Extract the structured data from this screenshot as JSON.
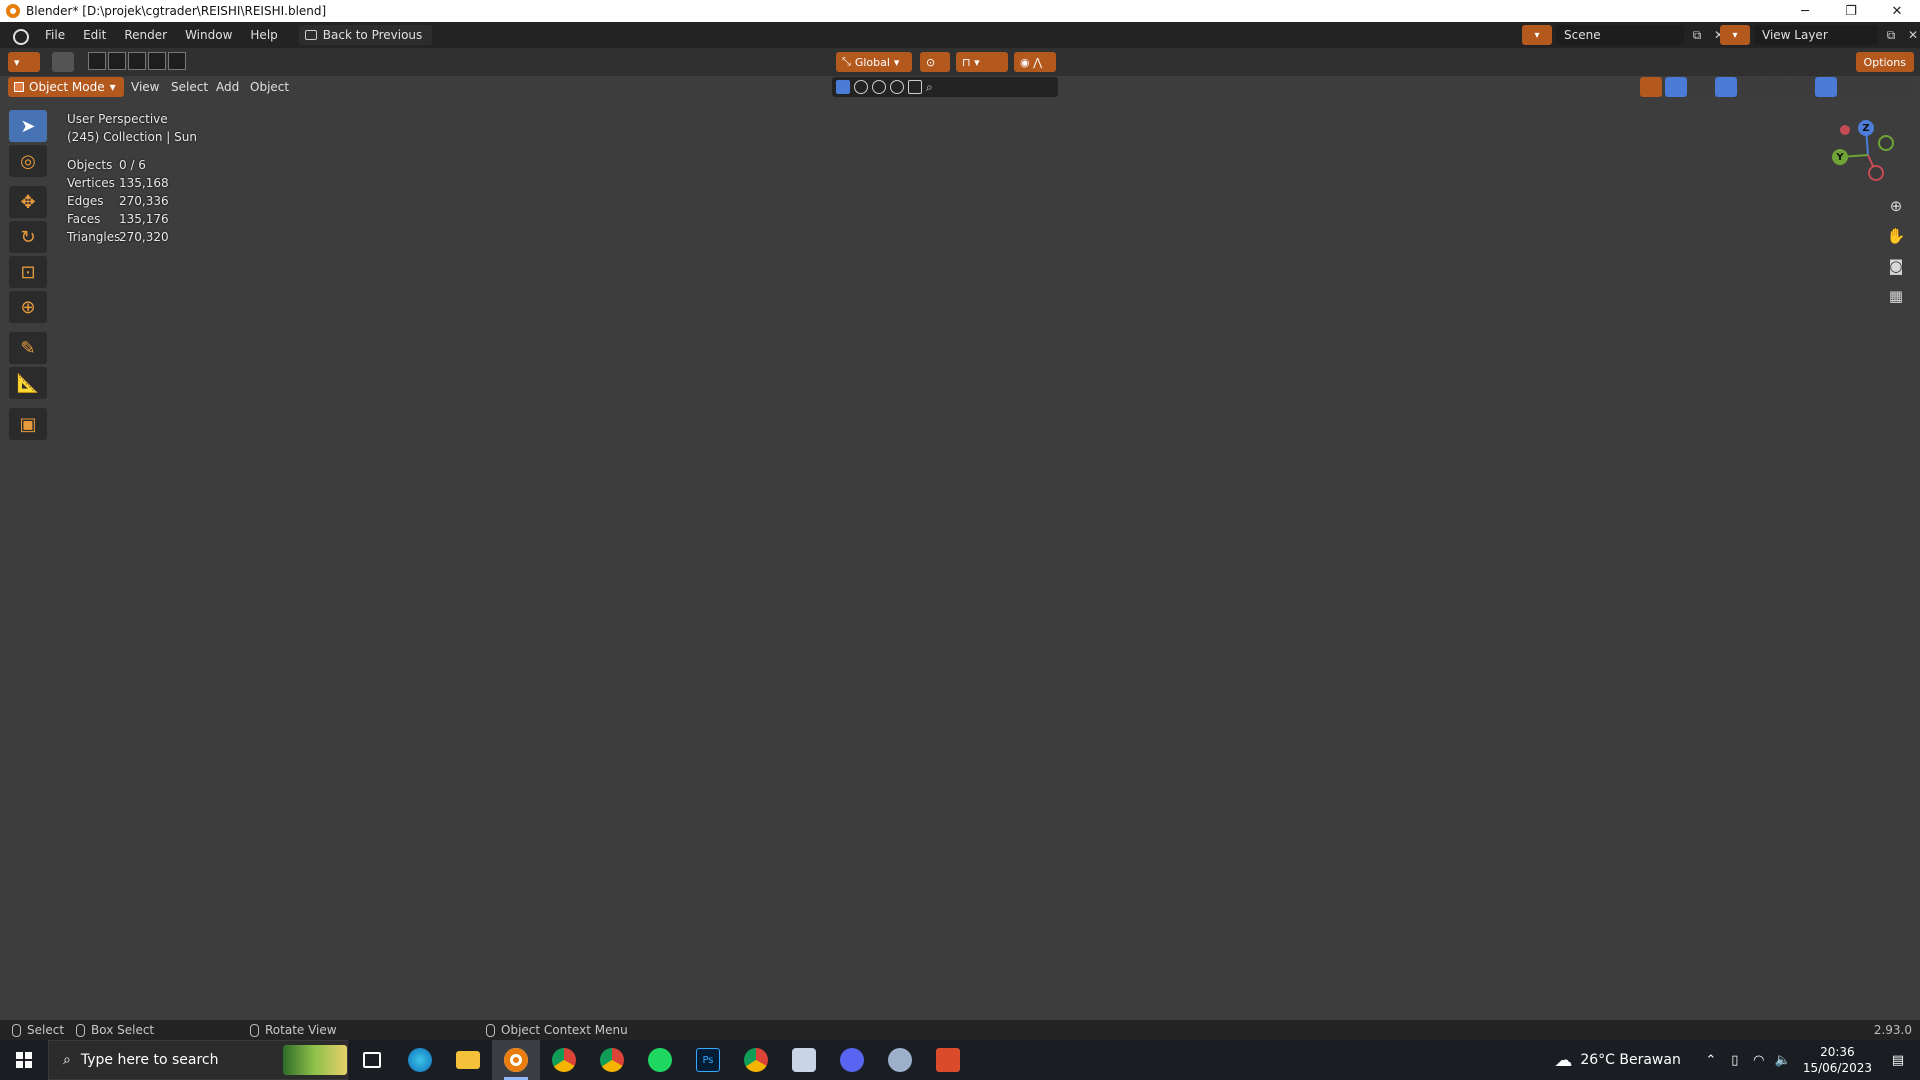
{
  "window": {
    "title": "Blender* [D:\\projek\\cgtrader\\REISHI\\REISHI.blend]",
    "minimize": "─",
    "restore": "❐",
    "close": "✕"
  },
  "menubar": {
    "items": [
      "File",
      "Edit",
      "Render",
      "Window",
      "Help"
    ],
    "back_button": "Back to Previous",
    "scene": "Scene",
    "view_layer": "View Layer"
  },
  "toolrow": {
    "transform_orientation": "Global",
    "options": "Options"
  },
  "header": {
    "mode": "Object Mode",
    "menus": [
      "View",
      "Select",
      "Add",
      "Object"
    ]
  },
  "overlay": {
    "view_name": "User Perspective",
    "collection": "(245) Collection | Sun",
    "stats": [
      {
        "label": "Objects",
        "value": "0 / 6"
      },
      {
        "label": "Vertices",
        "value": "135,168"
      },
      {
        "label": "Edges",
        "value": "270,336"
      },
      {
        "label": "Faces",
        "value": "135,176"
      },
      {
        "label": "Triangles",
        "value": "270,320"
      }
    ]
  },
  "gizmo": {
    "z": "Z",
    "y": "Y"
  },
  "toolbar": {
    "tools": [
      "select-box",
      "cursor",
      "move",
      "rotate",
      "scale",
      "transform",
      "annotate",
      "measure",
      "add-cube"
    ],
    "active": "select-box"
  },
  "statusbar": {
    "select": "Select",
    "box_select": "Box Select",
    "rotate_view": "Rotate View",
    "context_menu": "Object Context Menu",
    "version": "2.93.0"
  },
  "taskbar": {
    "search_placeholder": "Type here to search",
    "weather": "26°C  Berawan",
    "time": "20:36",
    "date": "15/06/2023"
  },
  "colors": {
    "accent": "#b4591e",
    "active_tool": "#4772b3",
    "x_axis": "#c54b55",
    "y_axis": "#6ea536",
    "z_axis": "#4c7ed9"
  }
}
